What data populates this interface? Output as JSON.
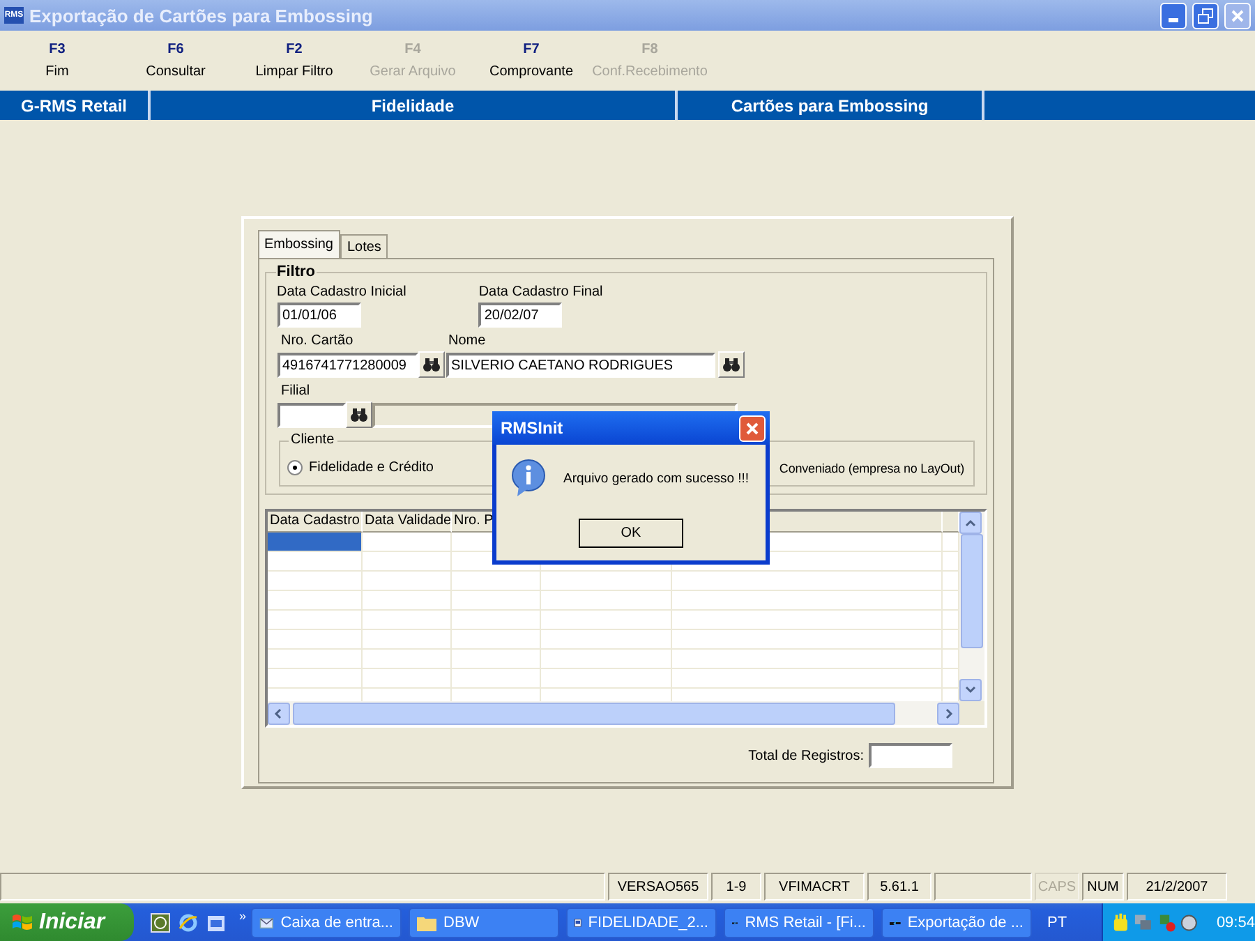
{
  "window": {
    "title": "Exportação de Cartões para Embossing",
    "app_icon": "RMS"
  },
  "toolbar": [
    {
      "key": "F3",
      "label": "Fim",
      "disabled": false
    },
    {
      "key": "F6",
      "label": "Consultar",
      "disabled": false
    },
    {
      "key": "F2",
      "label": "Limpar Filtro",
      "disabled": false
    },
    {
      "key": "F4",
      "label": "Gerar Arquivo",
      "disabled": true
    },
    {
      "key": "F7",
      "label": "Comprovante",
      "disabled": false
    },
    {
      "key": "F8",
      "label": "Conf.Recebimento",
      "disabled": true
    }
  ],
  "breadcrumb": [
    "G-RMS Retail",
    "Fidelidade",
    "Cartões para Embossing"
  ],
  "tabs": [
    {
      "label": "Embossing",
      "selected": true
    },
    {
      "label": "Lotes",
      "selected": false
    }
  ],
  "filter": {
    "title": "Filtro",
    "data_inicial": {
      "label": "Data Cadastro Inicial",
      "value": "01/01/06"
    },
    "data_final": {
      "label": "Data Cadastro Final",
      "value": "20/02/07"
    },
    "cartao": {
      "label": "Nro. Cartão",
      "value": "4916741771280009"
    },
    "nome": {
      "label": "Nome",
      "value": "SILVERIO CAETANO RODRIGUES"
    },
    "filial": {
      "label": "Filial"
    },
    "cliente": {
      "title": "Cliente",
      "options": [
        {
          "label": "Fidelidade e Crédito",
          "selected": true
        },
        {
          "label": "Conveniado (empresa no LayOut)"
        }
      ]
    }
  },
  "table": {
    "columns": [
      "Data Cadastro",
      "Data Validade",
      "Nro. P"
    ],
    "rows": [
      {
        "selected": true
      },
      {
        "selected": false
      },
      {
        "selected": false
      },
      {
        "selected": false
      },
      {
        "selected": false
      },
      {
        "selected": false
      },
      {
        "selected": false
      },
      {
        "selected": false
      },
      {
        "selected": false
      }
    ]
  },
  "total": {
    "label": "Total de Registros:"
  },
  "dialog": {
    "title": "RMSInit",
    "message": "Arquivo gerado com sucesso !!!",
    "button": "OK"
  },
  "status_bar": [
    {
      "disabled": false
    },
    {
      "text": "VERSAO565",
      "disabled": false
    },
    {
      "text": "1-9",
      "disabled": false
    },
    {
      "text": "VFIMACRT",
      "disabled": false
    },
    {
      "text": "5.61.1",
      "disabled": false
    },
    {
      "disabled": false
    },
    {
      "text": "CAPS",
      "disabled": true
    },
    {
      "text": "NUM",
      "disabled": false
    },
    {
      "text": "21/2/2007",
      "disabled": false
    }
  ],
  "taskbar": {
    "start": "Iniciar",
    "more": "»",
    "tasks": [
      {
        "label": "Caixa de entra...",
        "kind": "mail"
      },
      {
        "label": "DBW",
        "kind": "folder"
      },
      {
        "label": "FIDELIDADE_2...",
        "kind": "document"
      },
      {
        "label": "RMS Retail - [Fi...",
        "kind": "app"
      },
      {
        "label": "Exportação de ...",
        "kind": "app"
      }
    ],
    "language": "PT",
    "clock": "09:54"
  }
}
